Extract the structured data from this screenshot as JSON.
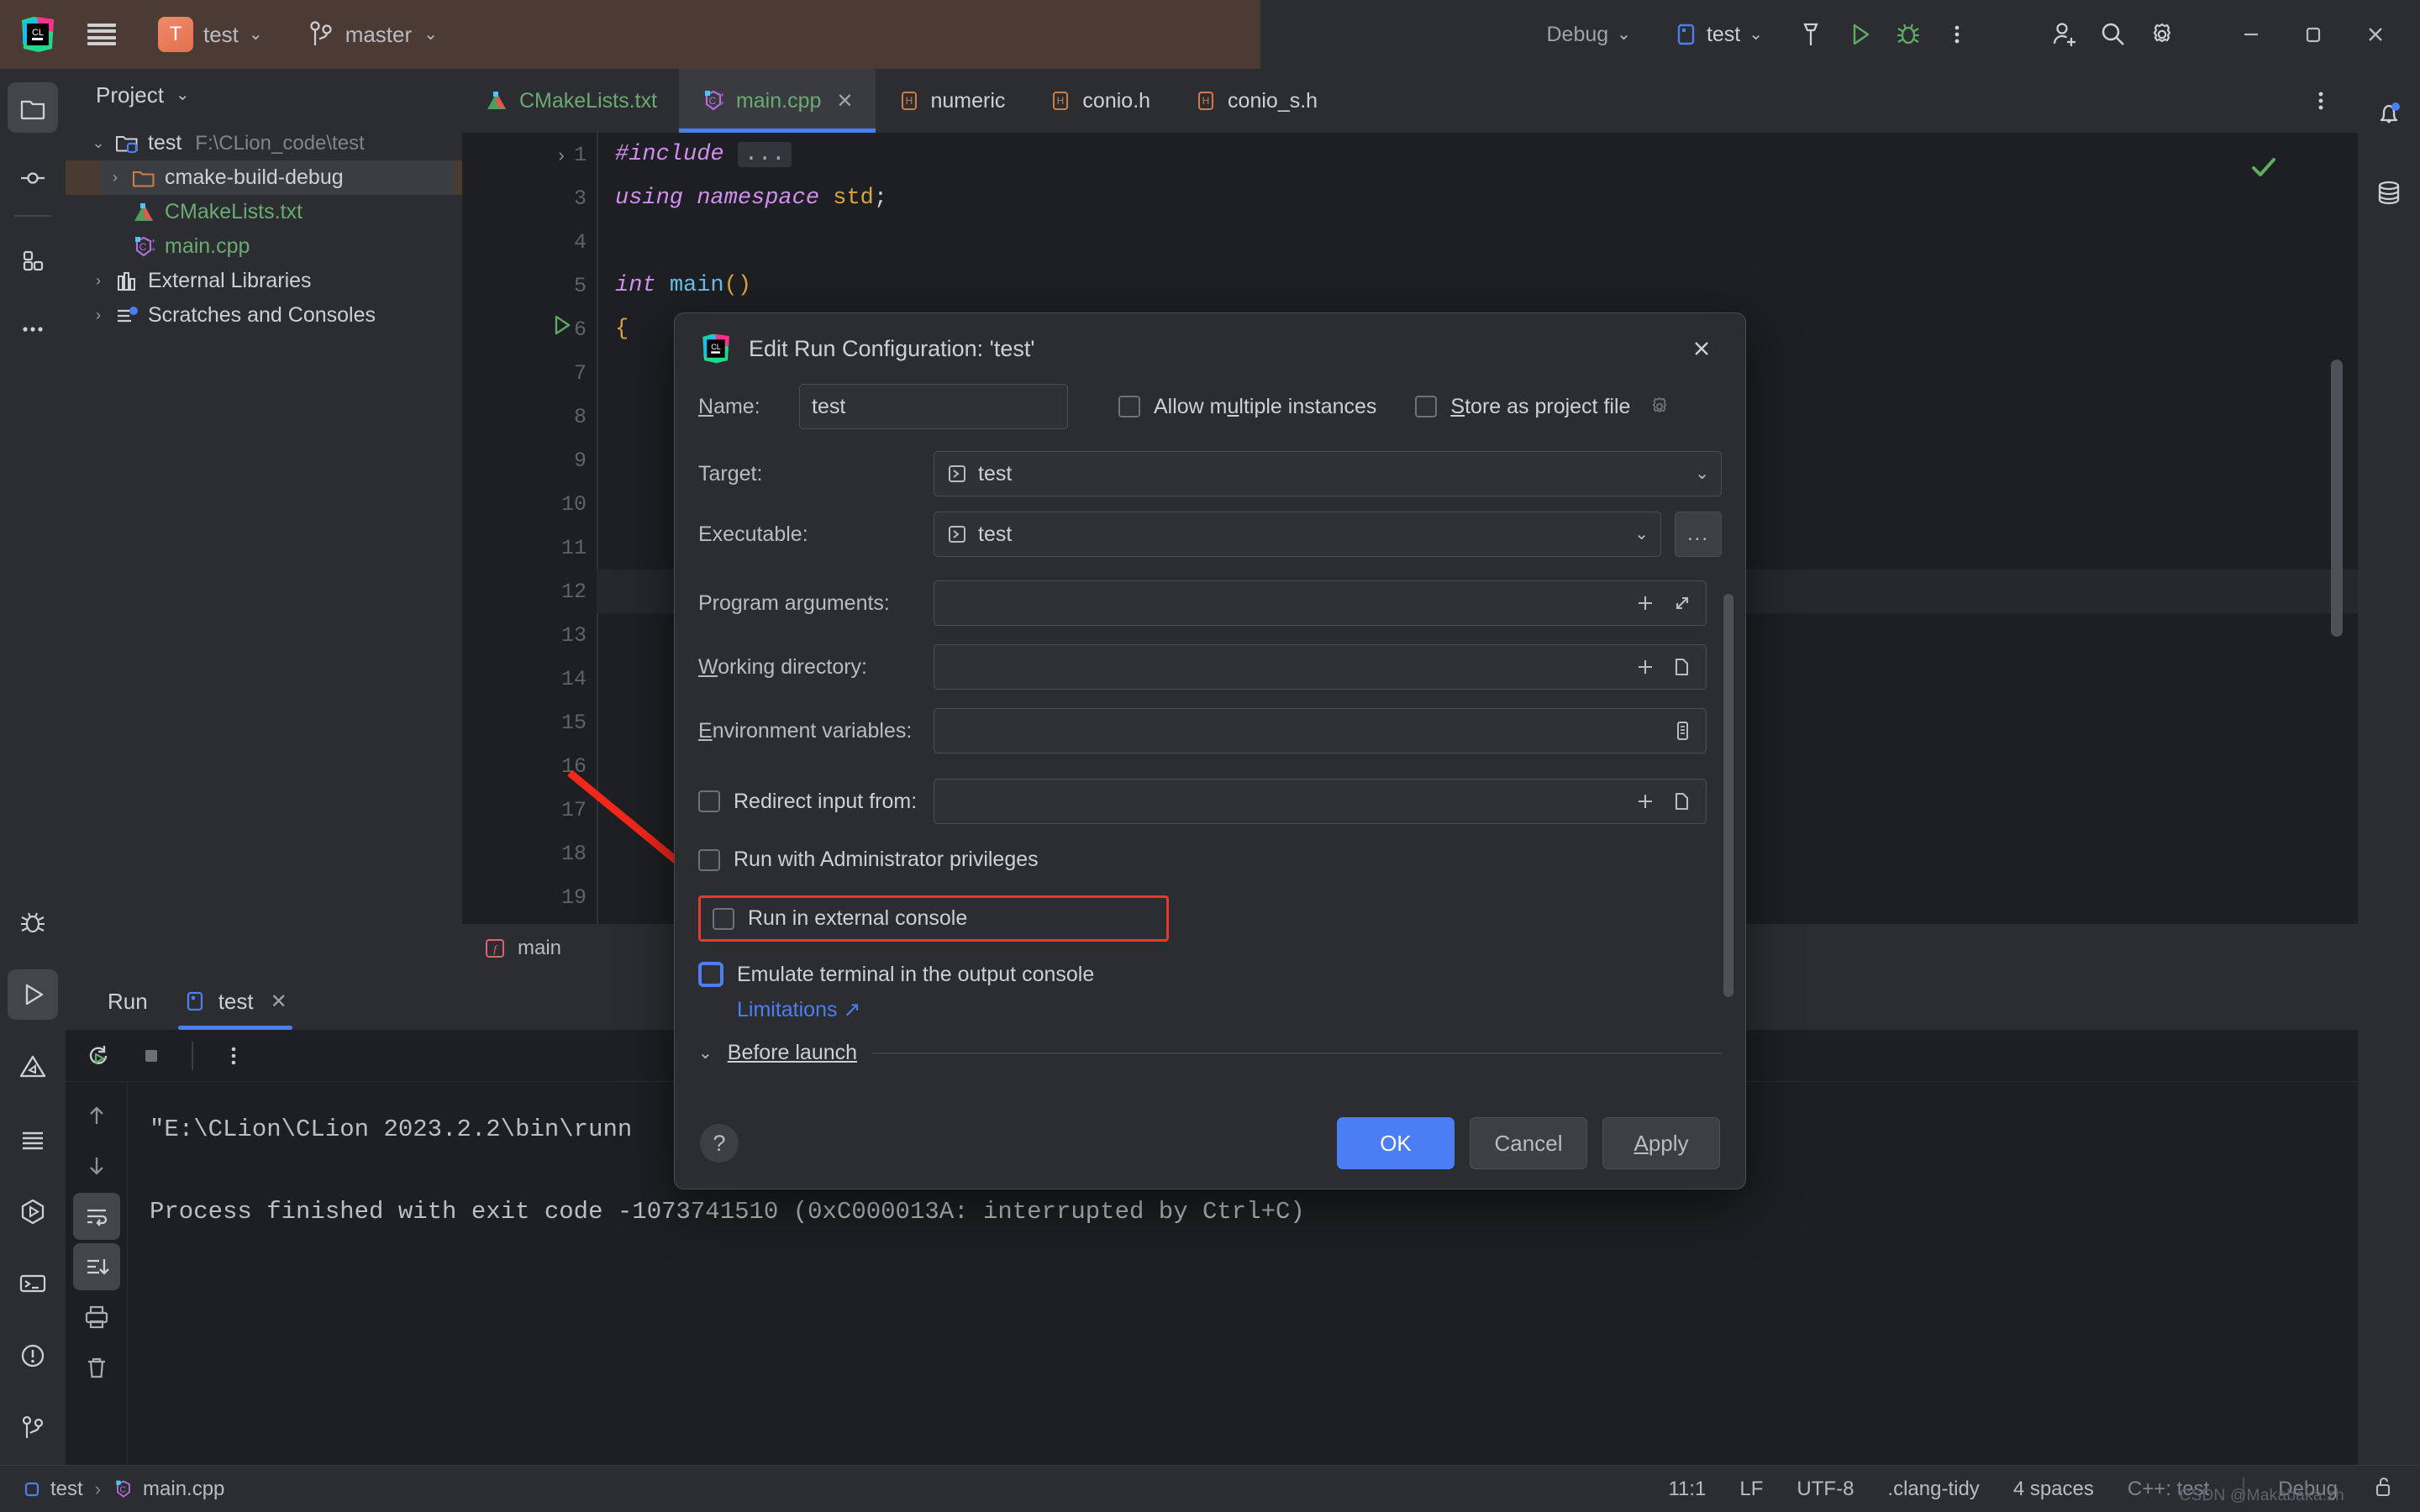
{
  "titlebar": {
    "project_initial": "T",
    "project_name": "test",
    "branch_name": "master",
    "run_mode": "Debug",
    "run_config": "test",
    "icons": {
      "logo": "clion-logo-icon",
      "menu": "hamburger-menu-icon",
      "vcs": "branch-icon",
      "build": "hammer-icon",
      "run": "run-icon",
      "debug": "debug-icon",
      "more": "more-vertical-icon",
      "account": "account-icon",
      "search": "search-icon",
      "settings": "gear-icon",
      "minimize": "minimize-icon",
      "maximize": "maximize-icon",
      "close": "close-icon"
    }
  },
  "left_stripe": {
    "items": [
      {
        "name": "project-tool-window",
        "icon": "folder-icon",
        "active": true
      },
      {
        "name": "commit-tool-window",
        "icon": "commit-icon",
        "active": false
      },
      {
        "name": "structure-tool-window",
        "icon": "structure-icon",
        "active": false
      },
      {
        "name": "more-tool-windows",
        "icon": "more-horizontal-icon",
        "active": false
      }
    ],
    "bottom_items": [
      {
        "name": "debug-tool-window",
        "icon": "bug-icon",
        "active": false
      },
      {
        "name": "run-tool-window",
        "icon": "run-triangle-icon",
        "active": true
      },
      {
        "name": "problems-tool-window",
        "icon": "warning-triangle-icon",
        "active": false
      },
      {
        "name": "todo-tool-window",
        "icon": "lines-icon",
        "active": false
      },
      {
        "name": "services-tool-window",
        "icon": "services-icon",
        "active": false
      },
      {
        "name": "terminal-tool-window",
        "icon": "terminal-icon",
        "active": false
      },
      {
        "name": "notifications-tool-window",
        "icon": "exclamation-circle-icon",
        "active": false
      },
      {
        "name": "version-control-tool-window",
        "icon": "branch-icon",
        "active": false
      }
    ]
  },
  "right_stripe": {
    "items": [
      {
        "name": "notifications",
        "icon": "bell-icon",
        "badge": true
      },
      {
        "name": "database",
        "icon": "database-icon",
        "badge": false
      }
    ]
  },
  "project_panel": {
    "title": "Project",
    "tree": [
      {
        "label": "test",
        "path": "F:\\CLion_code\\test",
        "icon": "project-folder-icon",
        "indent": 0,
        "twisty": "down",
        "selected": false,
        "color": "default"
      },
      {
        "label": "cmake-build-debug",
        "path": "",
        "icon": "folder-orange-icon",
        "indent": 1,
        "twisty": "right",
        "selected": true,
        "color": "default"
      },
      {
        "label": "CMakeLists.txt",
        "path": "",
        "icon": "cmake-icon",
        "indent": 1,
        "twisty": "none",
        "selected": false,
        "color": "green"
      },
      {
        "label": "main.cpp",
        "path": "",
        "icon": "cpp-icon",
        "indent": 1,
        "twisty": "none",
        "selected": false,
        "color": "green"
      },
      {
        "label": "External Libraries",
        "path": "",
        "icon": "libraries-icon",
        "indent": 0,
        "twisty": "right",
        "selected": false,
        "color": "default"
      },
      {
        "label": "Scratches and Consoles",
        "path": "",
        "icon": "scratches-icon",
        "indent": 0,
        "twisty": "right",
        "selected": false,
        "color": "default"
      }
    ]
  },
  "editor": {
    "tabs": [
      {
        "label": "CMakeLists.txt",
        "icon": "cmake-icon",
        "active": false,
        "closable": false,
        "color": "green"
      },
      {
        "label": "main.cpp",
        "icon": "cpp-icon",
        "active": true,
        "closable": true,
        "color": "green"
      },
      {
        "label": "numeric",
        "icon": "header-icon",
        "active": false,
        "closable": false,
        "color": "default"
      },
      {
        "label": "conio.h",
        "icon": "header-icon",
        "active": false,
        "closable": false,
        "color": "default"
      },
      {
        "label": "conio_s.h",
        "icon": "header-icon",
        "active": false,
        "closable": false,
        "color": "default"
      }
    ],
    "overflow_icon": "more-vertical-icon",
    "inspection_status_icon": "checkmark-icon",
    "lines": [
      {
        "num": "1",
        "gutter": "fold-right",
        "tokens": [
          {
            "t": "#include",
            "c": "kw"
          },
          {
            "t": " ",
            "c": "sem"
          },
          {
            "t": "...",
            "c": "el"
          }
        ]
      },
      {
        "num": "3",
        "gutter": "",
        "tokens": [
          {
            "t": "using namespace",
            "c": "kw"
          },
          {
            "t": " ",
            "c": "sem"
          },
          {
            "t": "std",
            "c": "br"
          },
          {
            "t": ";",
            "c": "sem"
          }
        ]
      },
      {
        "num": "4",
        "gutter": "",
        "tokens": []
      },
      {
        "num": "5",
        "gutter": "run",
        "tokens": [
          {
            "t": "int",
            "c": "kw"
          },
          {
            "t": " ",
            "c": "sem"
          },
          {
            "t": "main",
            "c": "fn"
          },
          {
            "t": "()",
            "c": "br"
          }
        ]
      },
      {
        "num": "6",
        "gutter": "",
        "tokens": [
          {
            "t": "{",
            "c": "br"
          }
        ]
      },
      {
        "num": "7",
        "gutter": "",
        "tokens": []
      },
      {
        "num": "8",
        "gutter": "",
        "tokens": []
      },
      {
        "num": "9",
        "gutter": "",
        "tokens": []
      },
      {
        "num": "10",
        "gutter": "",
        "tokens": []
      },
      {
        "num": "11",
        "gutter": "",
        "tokens": [],
        "current": true
      },
      {
        "num": "12",
        "gutter": "",
        "tokens": []
      },
      {
        "num": "13",
        "gutter": "",
        "tokens": []
      },
      {
        "num": "14",
        "gutter": "",
        "tokens": []
      },
      {
        "num": "15",
        "gutter": "",
        "tokens": []
      },
      {
        "num": "16",
        "gutter": "",
        "tokens": []
      },
      {
        "num": "17",
        "gutter": "",
        "tokens": []
      },
      {
        "num": "18",
        "gutter": "",
        "tokens": []
      },
      {
        "num": "19",
        "gutter": "",
        "tokens": []
      }
    ],
    "breadcrumb": {
      "label": "main",
      "icon": "function-icon"
    }
  },
  "run_window": {
    "tool_label": "Run",
    "tab_label": "test",
    "tab_icon": "run-config-icon",
    "tab_close_icon": "close-icon",
    "toolbar": [
      {
        "name": "rerun-button",
        "icon": "rerun-icon"
      },
      {
        "name": "stop-button",
        "icon": "stop-square-icon"
      },
      {
        "name": "more-options-button",
        "icon": "more-vertical-icon"
      }
    ],
    "console_gutter": [
      {
        "name": "scroll-up-button",
        "icon": "arrow-up-icon",
        "on": false
      },
      {
        "name": "scroll-down-button",
        "icon": "arrow-down-icon",
        "on": false
      },
      {
        "name": "soft-wrap-button",
        "icon": "soft-wrap-icon",
        "on": true
      },
      {
        "name": "scroll-to-end-button",
        "icon": "scroll-end-icon",
        "on": true
      },
      {
        "name": "print-button",
        "icon": "printer-icon",
        "on": false
      },
      {
        "name": "clear-all-button",
        "icon": "trash-icon",
        "on": false
      }
    ],
    "console_lines": [
      "\"E:\\CLion\\CLion 2023.2.2\\bin\\runn",
      "Process finished with exit code -1073741510 (0xC000013A: interrupted by Ctrl+C)"
    ]
  },
  "dialog": {
    "title": "Edit Run Configuration: 'test'",
    "logo_icon": "clion-logo-icon",
    "close_icon": "close-icon",
    "name_label": "Name:",
    "name_label_mnemonic": "N",
    "name_value": "test",
    "allow_multiple_label": "Allow multiple instances",
    "allow_multiple_checked": false,
    "store_as_project_label": "Store as project file",
    "store_as_project_checked": false,
    "store_gear_icon": "gear-icon",
    "target_label": "Target:",
    "target_value": "test",
    "target_icon": "target-icon",
    "executable_label": "Executable:",
    "executable_value": "test",
    "executable_icon": "target-icon",
    "browse_button_label": "...",
    "program_arguments_label": "Program arguments:",
    "program_arguments_value": "",
    "program_arguments_icons": [
      "plus-icon",
      "expand-icon"
    ],
    "working_directory_label": "Working directory:",
    "working_directory_value": "",
    "working_directory_icons": [
      "plus-icon",
      "folder-icon"
    ],
    "environment_variables_label": "Environment variables:",
    "environment_variables_value": "",
    "environment_variables_icons": [
      "list-icon"
    ],
    "redirect_input_label": "Redirect input from:",
    "redirect_input_checked": false,
    "redirect_input_value": "",
    "redirect_input_icons": [
      "plus-icon",
      "folder-icon"
    ],
    "run_admin_label": "Run with Administrator privileges",
    "run_admin_checked": false,
    "run_external_console_label": "Run in external console",
    "run_external_console_checked": false,
    "run_external_console_highlight_color": "#e8392e",
    "emulate_terminal_label": "Emulate terminal in the output console",
    "emulate_terminal_checked": false,
    "emulate_terminal_focused": true,
    "limitations_link": "Limitations ↗",
    "before_launch_label": "Before launch",
    "before_launch_collapsed": false,
    "help_button_label": "?",
    "ok_label": "OK",
    "cancel_label": "Cancel",
    "apply_label": "Apply",
    "accent_color": "#4c7ef3"
  },
  "statusbar": {
    "breadcrumb": [
      {
        "label": "test",
        "icon": "project-icon"
      },
      {
        "label": "main.cpp",
        "icon": "cpp-icon"
      }
    ],
    "separator": "›",
    "right_items": [
      {
        "name": "caret-position",
        "label": "11:1",
        "dim": false
      },
      {
        "name": "line-separator",
        "label": "LF",
        "dim": false
      },
      {
        "name": "file-encoding",
        "label": "UTF-8",
        "dim": false
      },
      {
        "name": "clang-tidy",
        "label": ".clang-tidy",
        "dim": false
      },
      {
        "name": "indentation",
        "label": "4 spaces",
        "dim": false
      },
      {
        "name": "cmake-profile",
        "label": "C++: test",
        "dim": true
      },
      {
        "name": "build-type",
        "label": "Debug",
        "dim": true
      }
    ],
    "lock_icon": "unlocked-icon",
    "watermark": "CSDN @Makabaka.zh"
  }
}
